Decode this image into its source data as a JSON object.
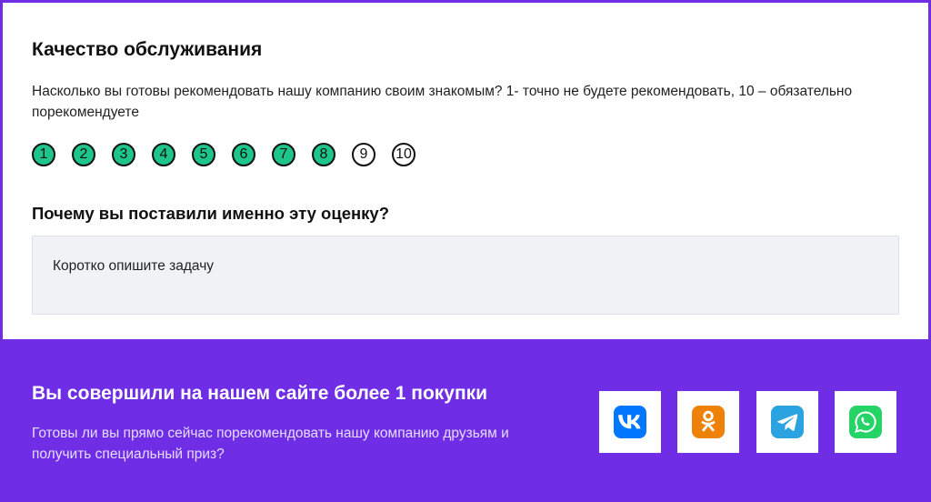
{
  "survey": {
    "title": "Качество обслуживания",
    "question": "Насколько вы готовы рекомендовать нашу компанию своим знакомым? 1- точно не будете рекомендовать, 10 – обязательно порекомендуете",
    "scale": [
      "1",
      "2",
      "3",
      "4",
      "5",
      "6",
      "7",
      "8",
      "9",
      "10"
    ],
    "selected_value": 8,
    "why_label": "Почему вы поставили именно эту оценку?",
    "textarea_placeholder": "Коротко опишите задачу"
  },
  "promo": {
    "title": "Вы совершили на нашем сайте более 1 покупки",
    "text": "Готовы ли вы прямо сейчас порекомендовать нашу компанию друзьям и получить специальный приз?"
  },
  "social": [
    {
      "icon": "vk-icon",
      "color": "#0077ff"
    },
    {
      "icon": "odnoklassniki-icon",
      "color": "#ee8208"
    },
    {
      "icon": "telegram-icon",
      "color": "#2aa3e0"
    },
    {
      "icon": "whatsapp-icon",
      "color": "#25d366"
    }
  ],
  "colors": {
    "accent": "#6f2ee6",
    "selected": "#1dc58a",
    "input_bg": "#f1f2f6"
  }
}
